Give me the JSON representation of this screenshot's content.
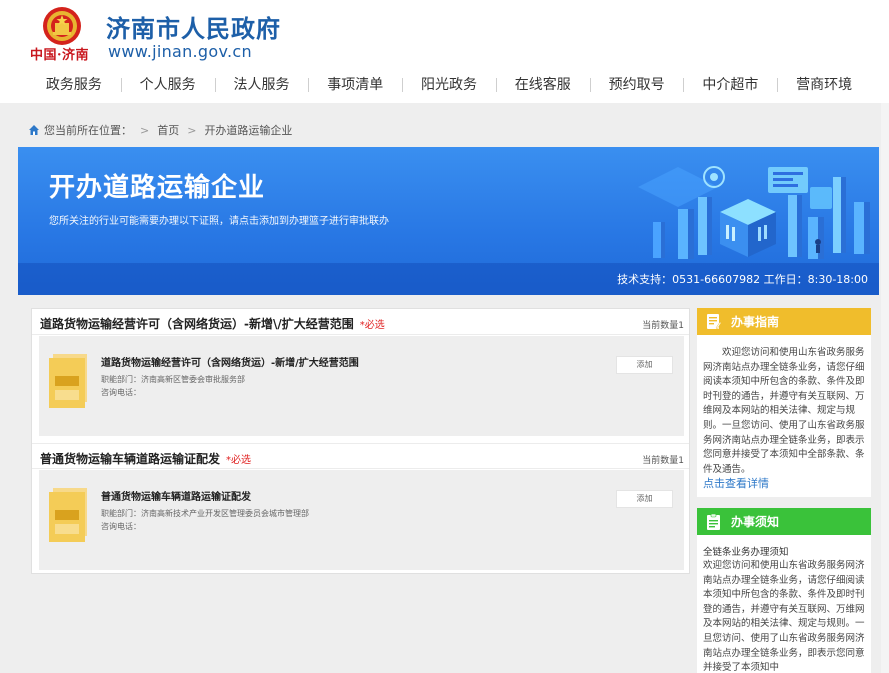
{
  "header": {
    "site_title": "济南市人民政府",
    "site_url": "www.jinan.gov.cn",
    "brand_sub": "中国·济南"
  },
  "nav": {
    "items": [
      "政务服务",
      "个人服务",
      "法人服务",
      "事项清单",
      "阳光政务",
      "在线客服",
      "预约取号",
      "中介超市",
      "营商环境"
    ]
  },
  "breadcrumb": {
    "prefix": "您当前所在位置：",
    "home": "首页",
    "current": "开办道路运输企业"
  },
  "banner": {
    "title": "开办道路运输企业",
    "subtitle": "您所关注的行业可能需要办理以下证照，请点击添加到办理篮子进行审批联办",
    "support": "技术支持：0531-66607982  工作日：8:30-18:00"
  },
  "sections": [
    {
      "title": "道路货物运输经营许可（含网络货运）-新增\\/扩大经营范围",
      "required": "*必选",
      "count": "当前数量1",
      "item": {
        "name": "道路货物运输经营许可（含网络货运）-新增/扩大经营范围",
        "dept": "职能部门：济南高新区管委会审批服务部",
        "phone": "咨询电话：",
        "add": "添加"
      }
    },
    {
      "title": "普通货物运输车辆道路运输证配发",
      "required": "*必选",
      "count": "当前数量1",
      "item": {
        "name": "普通货物运输车辆道路运输证配发",
        "dept": "职能部门：济南高新技术产业开发区管理委员会城市管理部",
        "phone": "咨询电话：",
        "add": "添加"
      }
    }
  ],
  "guide": {
    "title": "办事指南",
    "body": "欢迎您访问和使用山东省政务服务网济南站点办理全链条业务，请您仔细阅读本须知中所包含的条款、条件及即时刊登的通告，并遵守有关互联网、万维网及本网站的相关法律、规定与规则。一旦您访问、使用了山东省政务服务网济南站点办理全链条业务，即表示您同意并接受了本须知中全部条款、条件及通告。",
    "link": "点击查看详情"
  },
  "notice": {
    "title": "办事须知",
    "subtitle": "全链条业务办理须知",
    "body": "欢迎您访问和使用山东省政务服务网济南站点办理全链条业务，请您仔细阅读本须知中所包含的条款、条件及即时刊登的通告，并遵守有关互联网、万维网及本网站的相关法律、规定与规则。一旦您访问、使用了山东省政务服务网济南站点办理全链条业务，即表示您同意并接受了本须知中"
  },
  "colors": {
    "brand_blue": "#1d5fa8",
    "banner_blue": "#2877e4",
    "guide_yellow": "#f0bd2c",
    "notice_green": "#3ac23a",
    "required_red": "#e02020",
    "link_blue": "#2d78c8"
  }
}
